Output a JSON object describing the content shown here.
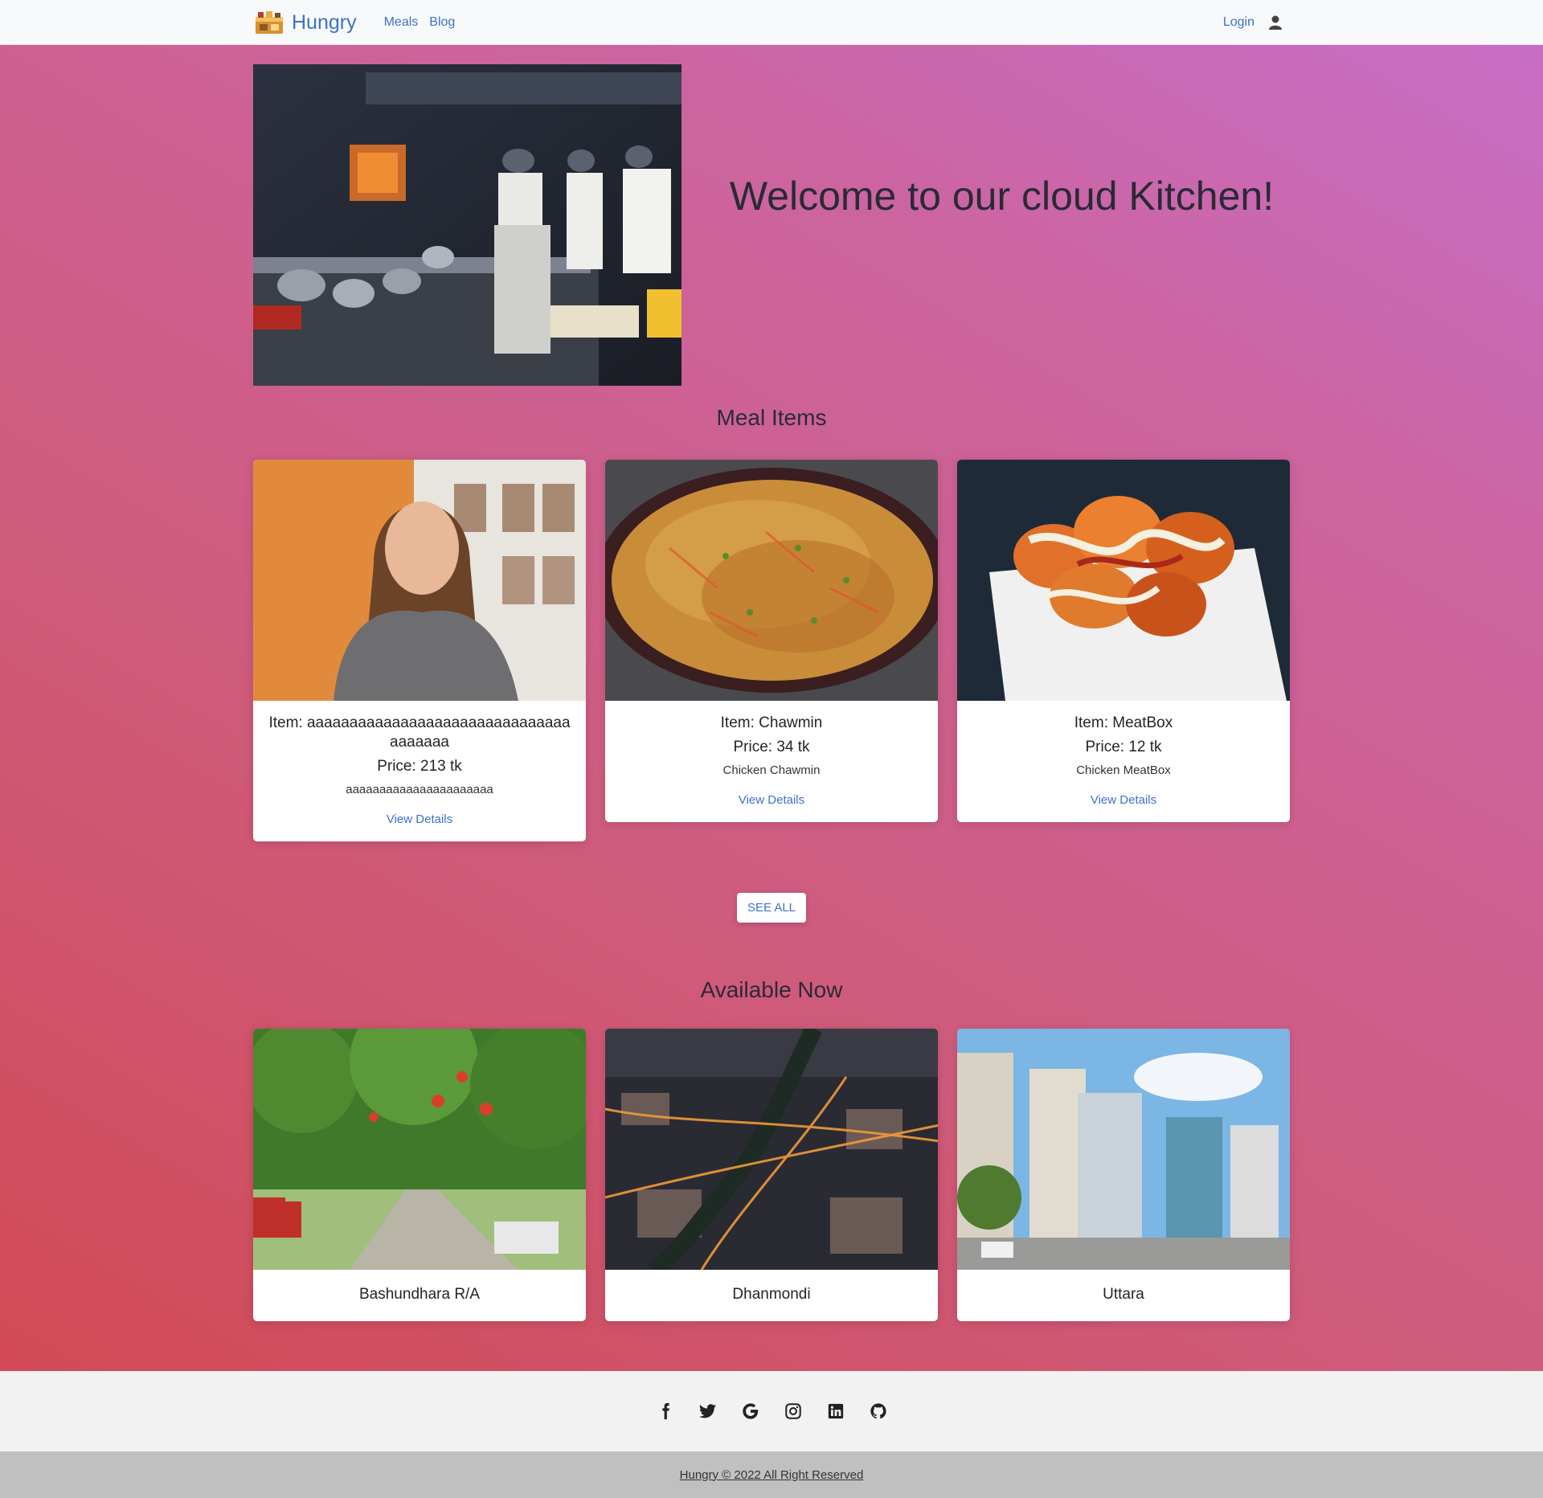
{
  "navbar": {
    "brand": "Hungry",
    "links": [
      "Meals",
      "Blog"
    ],
    "login": "Login"
  },
  "hero": {
    "title": "Welcome to our cloud Kitchen!"
  },
  "meals": {
    "title": "Meal Items",
    "items": [
      {
        "name": "Item: aaaaaaaaaaaaaaaaaaaaaaaaaaaaaaaaaaaaaa",
        "price": "Price: 213 tk",
        "desc": "aaaaaaaaaaaaaaaaaaaaaa",
        "link": "View Details"
      },
      {
        "name": "Item: Chawmin",
        "price": "Price: 34 tk",
        "desc": "Chicken Chawmin",
        "link": "View Details"
      },
      {
        "name": "Item: MeatBox",
        "price": "Price: 12 tk",
        "desc": "Chicken MeatBox",
        "link": "View Details"
      }
    ],
    "see_all": "SEE ALL"
  },
  "available": {
    "title": "Available Now",
    "locations": [
      "Bashundhara R/A",
      "Dhanmondi",
      "Uttara"
    ]
  },
  "footer": {
    "icons": [
      "facebook-icon",
      "twitter-icon",
      "google-icon",
      "instagram-icon",
      "linkedin-icon",
      "github-icon"
    ],
    "copyright": "Hungry © 2022 All Right Reserved"
  }
}
